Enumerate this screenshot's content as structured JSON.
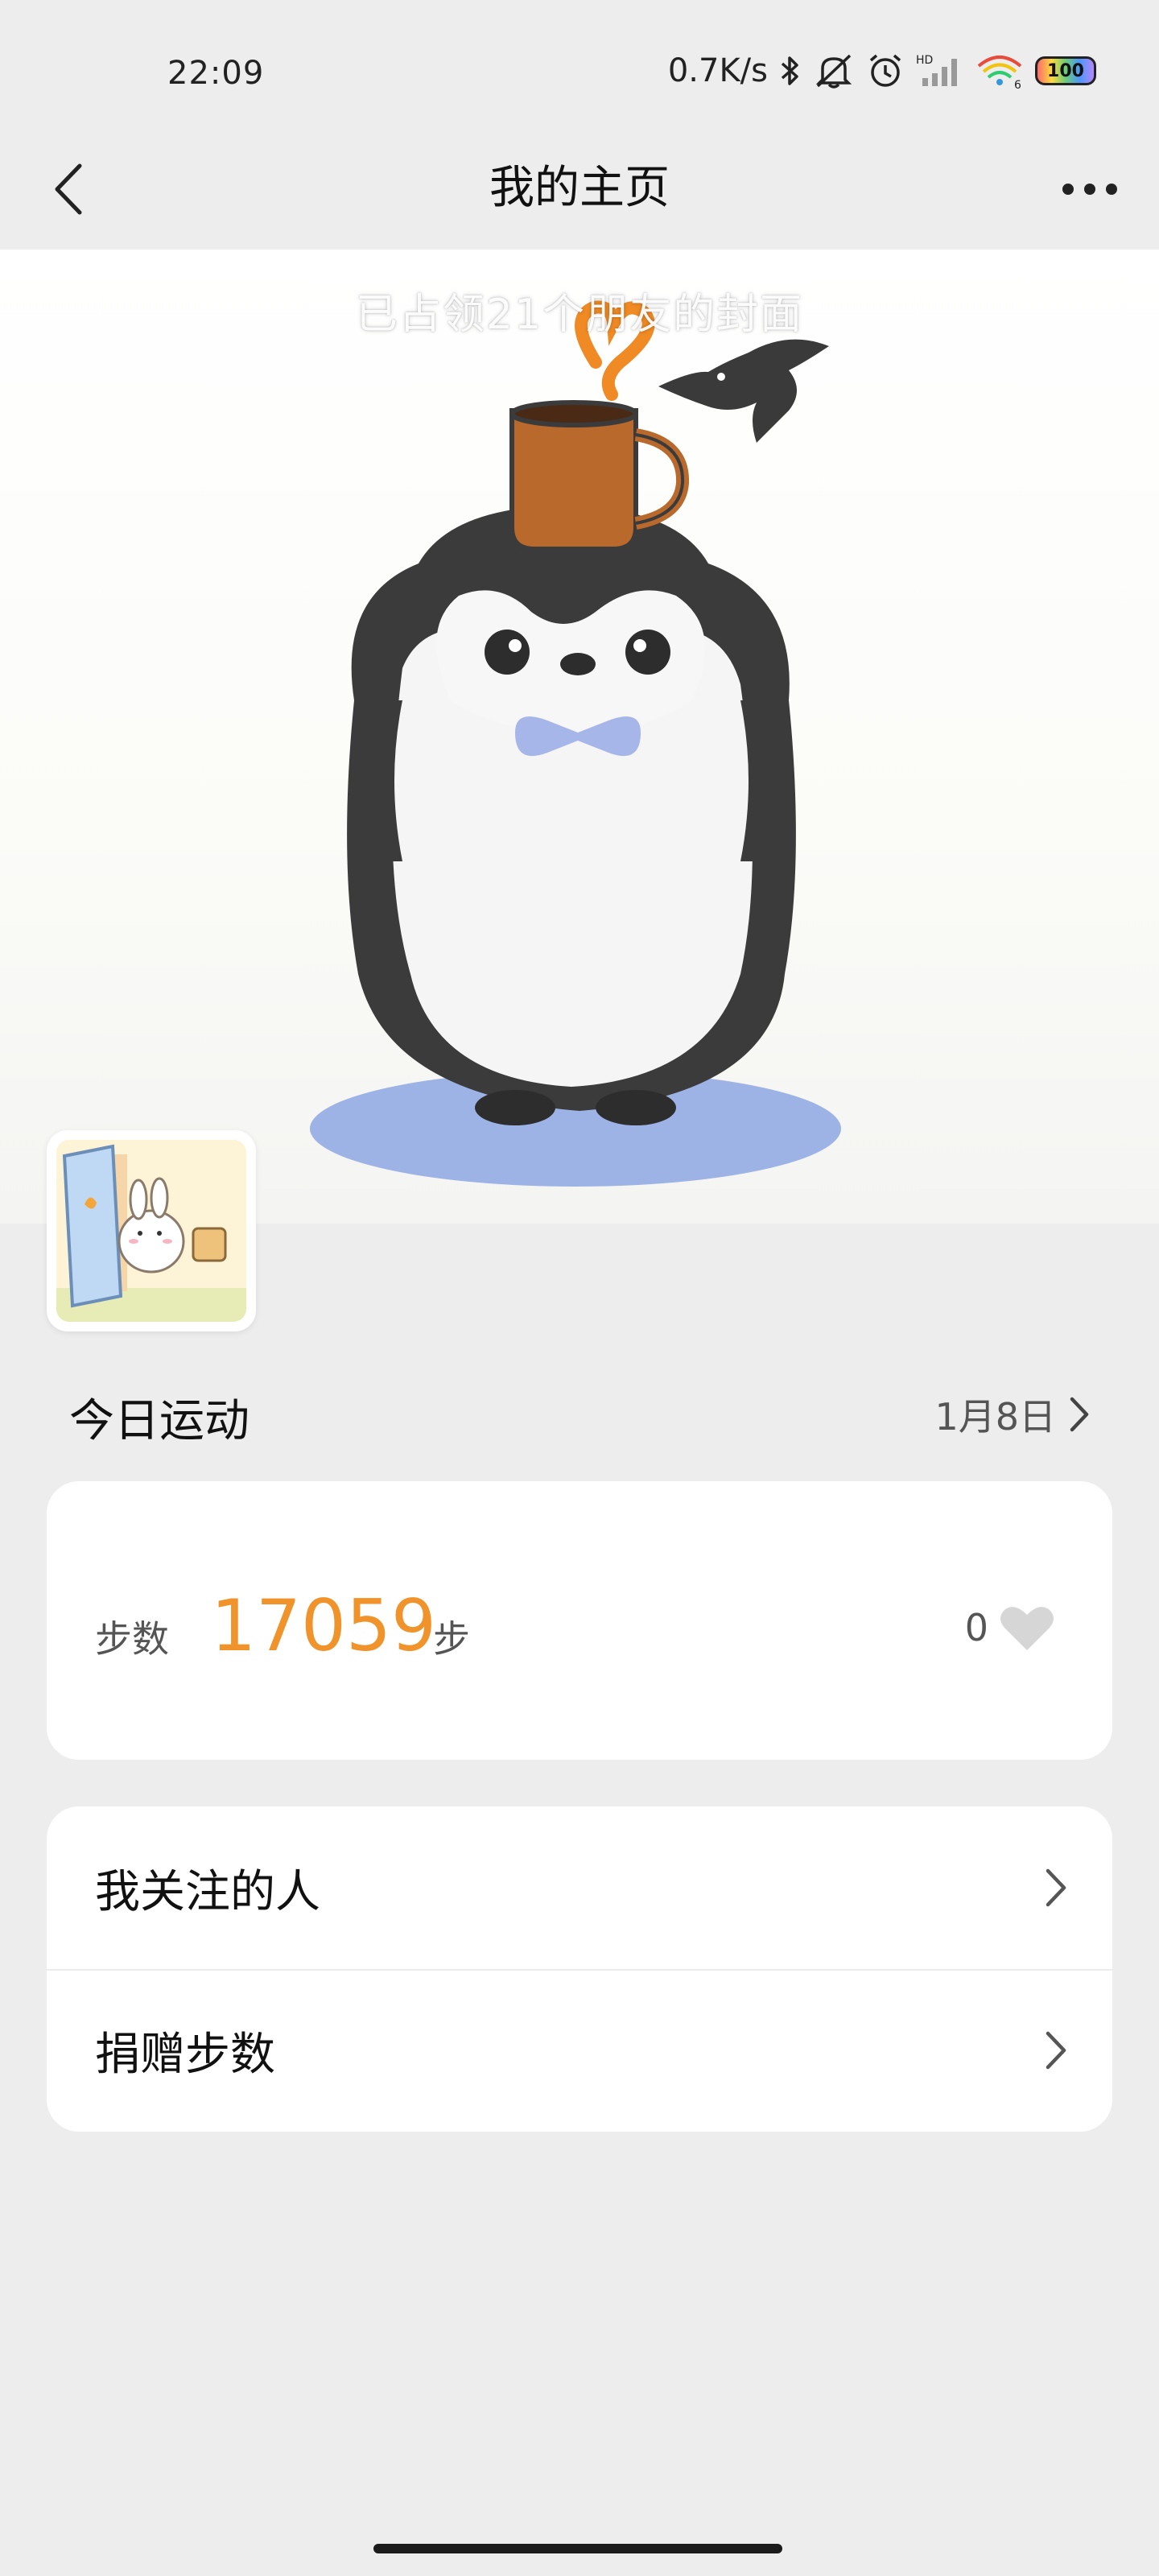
{
  "status_bar": {
    "time": "22:09",
    "network_speed": "0.7K/s",
    "battery_level": "100",
    "signal_label": "HD",
    "wifi_label": "6",
    "icons": [
      "bluetooth-icon",
      "mute-icon",
      "alarm-icon",
      "cell-signal-icon",
      "wifi-icon",
      "battery-icon"
    ]
  },
  "nav": {
    "title": "我的主页",
    "back_icon": "chevron-left-icon",
    "more_icon": "more-dots-icon"
  },
  "cover": {
    "caption": "已占领21个朋友的封面"
  },
  "today": {
    "title": "今日运动",
    "date": "1月8日"
  },
  "steps": {
    "label": "步数",
    "value": "17059",
    "unit": "步",
    "likes": "0",
    "like_color": "#d6d6d6",
    "value_color": "#f0932b"
  },
  "menu": {
    "items": [
      {
        "label": "我关注的人"
      },
      {
        "label": "捐赠步数"
      }
    ]
  }
}
